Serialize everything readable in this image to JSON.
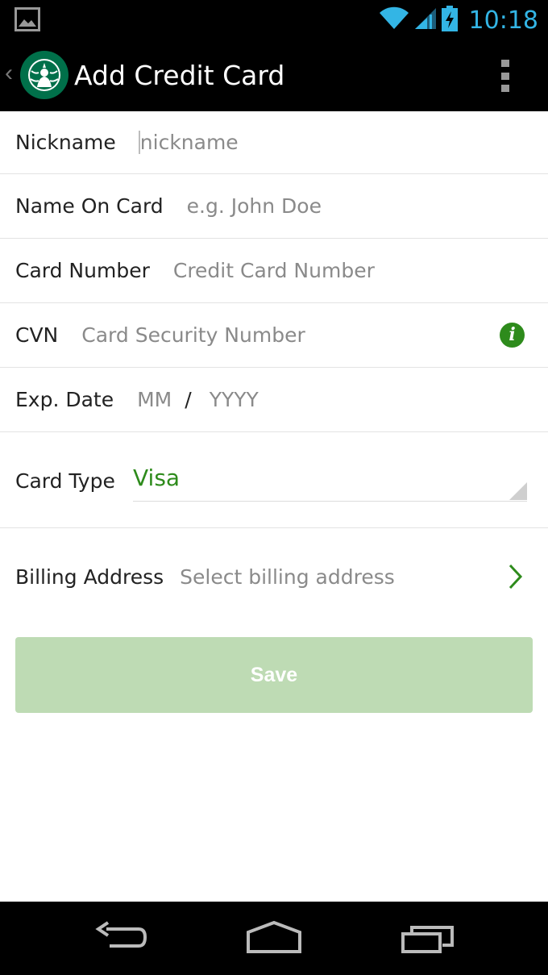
{
  "status_bar": {
    "time": "10:18",
    "icons": [
      "gallery-notification-icon",
      "wifi-icon",
      "signal-icon",
      "battery-charging-icon"
    ]
  },
  "action_bar": {
    "title": "Add Credit Card",
    "logo": "starbucks-logo",
    "overflow_icon": "overflow-menu-icon"
  },
  "form": {
    "nickname": {
      "label": "Nickname",
      "placeholder": "nickname"
    },
    "name_on_card": {
      "label": "Name On Card",
      "placeholder": "e.g. John Doe"
    },
    "card_number": {
      "label": "Card Number",
      "placeholder": "Credit Card Number"
    },
    "cvn": {
      "label": "CVN",
      "placeholder": "Card Security Number",
      "info_icon": "i"
    },
    "exp_date": {
      "label": "Exp. Date",
      "month_placeholder": "MM",
      "separator": "/",
      "year_placeholder": "YYYY"
    },
    "card_type": {
      "label": "Card Type",
      "selected": "Visa"
    },
    "billing_address": {
      "label": "Billing Address",
      "placeholder": "Select billing address"
    }
  },
  "save_button": {
    "label": "Save"
  },
  "colors": {
    "accent_green": "#2e8b1c",
    "save_disabled": "#bedbb4",
    "status_blue": "#33b5e5"
  },
  "nav_bar": {
    "icons": [
      "back-icon",
      "home-icon",
      "recent-apps-icon"
    ]
  }
}
